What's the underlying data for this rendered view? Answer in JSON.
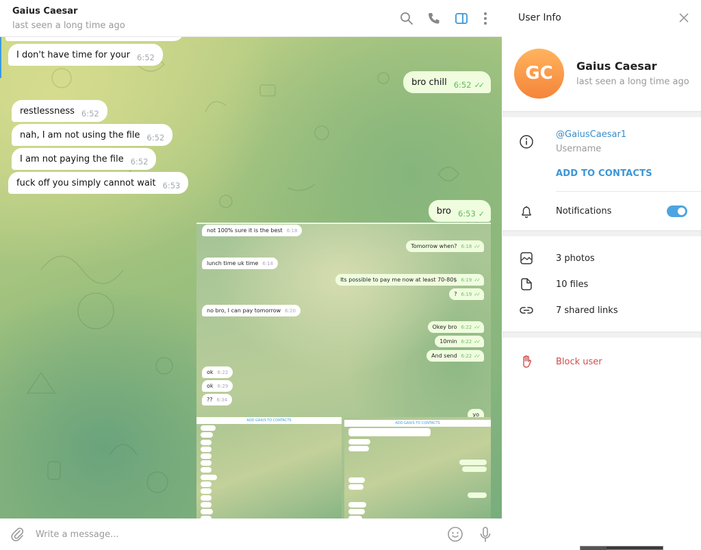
{
  "chat": {
    "title": "Gaius Caesar",
    "status": "last seen a long time ago",
    "header_icons": [
      "search-icon",
      "phone-icon",
      "sidebar-toggle-icon",
      "more-vertical-icon"
    ],
    "messages": [
      {
        "dir": "in",
        "text": "I don't have time for your",
        "time": "6:52"
      },
      {
        "dir": "out",
        "text": "bro chill",
        "time": "6:52",
        "ticks": "✓✓"
      },
      {
        "dir": "in",
        "text": "restlessness",
        "time": "6:52"
      },
      {
        "dir": "in",
        "text": "nah, I am not using the file",
        "time": "6:52"
      },
      {
        "dir": "in",
        "text": "I am not paying the file",
        "time": "6:52"
      },
      {
        "dir": "in",
        "text": "fuck off you simply cannot wait",
        "time": "6:53"
      },
      {
        "dir": "out",
        "text": "bro",
        "time": "6:53",
        "ticks": "✓"
      }
    ],
    "screenshot": {
      "messages": [
        {
          "dir": "in",
          "text": "not 100% sure it is the best",
          "time": "6:18"
        },
        {
          "dir": "out",
          "text": "Tomorrow when?",
          "time": "6:18",
          "ticks": "✓✓"
        },
        {
          "dir": "in",
          "text": "lunch time uk time",
          "time": "6:18"
        },
        {
          "dir": "out",
          "text": "Its possible to pay me now at least 70-80$",
          "time": "6:19",
          "ticks": "✓✓"
        },
        {
          "dir": "out",
          "text": "?",
          "time": "6:19",
          "ticks": "✓✓"
        },
        {
          "dir": "in",
          "text": "no bro, I can pay tomorrow",
          "time": "6:20"
        },
        {
          "dir": "out",
          "text": "Okey bro",
          "time": "6:22",
          "ticks": "✓✓"
        },
        {
          "dir": "out",
          "text": "10min",
          "time": "6:22",
          "ticks": "✓✓"
        },
        {
          "dir": "out",
          "text": "And send",
          "time": "6:22",
          "ticks": "✓✓"
        },
        {
          "dir": "in",
          "text": "ok",
          "time": "6:22"
        },
        {
          "dir": "in",
          "text": "ok",
          "time": "6:29"
        },
        {
          "dir": "in",
          "text": "??",
          "time": "6:34"
        },
        {
          "dir": "out",
          "text": "yo",
          "time": "",
          "ticks": ""
        }
      ],
      "nested_banner": "ADD GAIUS TO CONTACTS"
    },
    "composer": {
      "placeholder": "Write a message..."
    }
  },
  "user_info": {
    "title": "User Info",
    "avatar_initials": "GC",
    "avatar_color": "#f7933f",
    "name": "Gaius Caesar",
    "status": "last seen a long time ago",
    "username": "@GaiusCaesar1",
    "username_label": "Username",
    "add_to_contacts": "ADD TO CONTACTS",
    "notifications_label": "Notifications",
    "notifications_on": true,
    "media": [
      {
        "icon": "photo-icon",
        "label": "3 photos"
      },
      {
        "icon": "file-icon",
        "label": "10 files"
      },
      {
        "icon": "link-icon",
        "label": "7 shared links"
      }
    ],
    "block_user": "Block user"
  },
  "colors": {
    "accent": "#3a95d5",
    "danger": "#d24a4a",
    "outgoing_bubble": "#effdde",
    "read_ticks": "#5fbb5a"
  }
}
